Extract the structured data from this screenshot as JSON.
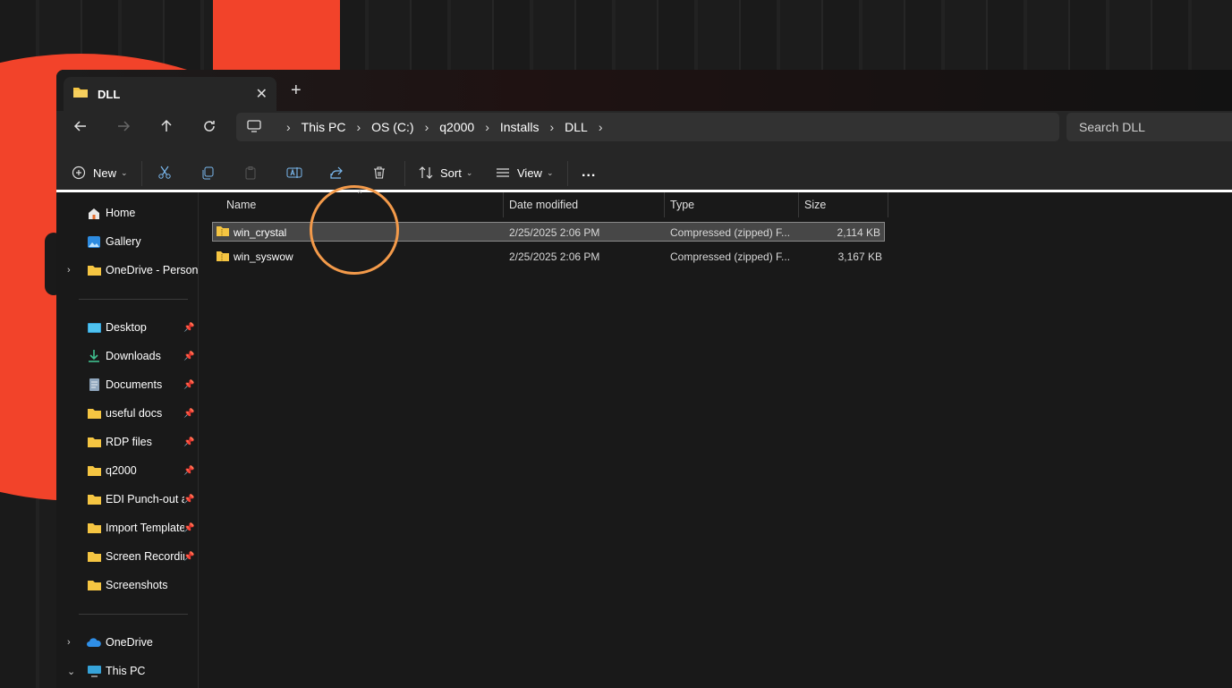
{
  "window": {
    "tab_title": "DLL"
  },
  "nav": {
    "breadcrumbs": [
      "This PC",
      "OS (C:)",
      "q2000",
      "Installs",
      "DLL"
    ],
    "search_placeholder": "Search DLL"
  },
  "toolbar": {
    "new_label": "New",
    "sort_label": "Sort",
    "view_label": "View",
    "more_label": "..."
  },
  "sidebar": {
    "items": [
      {
        "label": "Home",
        "icon": "home-icon"
      },
      {
        "label": "Gallery",
        "icon": "gallery-icon"
      },
      {
        "label": "OneDrive - Persona",
        "icon": "folder-icon"
      },
      {
        "label": "Desktop",
        "icon": "desktop-icon",
        "pinned": true
      },
      {
        "label": "Downloads",
        "icon": "download-icon",
        "pinned": true
      },
      {
        "label": "Documents",
        "icon": "documents-icon",
        "pinned": true
      },
      {
        "label": "useful docs",
        "icon": "folder-icon",
        "pinned": true
      },
      {
        "label": "RDP files",
        "icon": "folder-icon",
        "pinned": true
      },
      {
        "label": "q2000",
        "icon": "folder-icon",
        "pinned": true
      },
      {
        "label": "EDI Punch-out a",
        "icon": "folder-icon",
        "pinned": true
      },
      {
        "label": "Import Template",
        "icon": "folder-icon",
        "pinned": true
      },
      {
        "label": "Screen Recordin",
        "icon": "folder-icon",
        "pinned": true
      },
      {
        "label": "Screenshots",
        "icon": "folder-icon"
      },
      {
        "label": "OneDrive",
        "icon": "cloud-icon"
      },
      {
        "label": "This PC",
        "icon": "pc-icon"
      }
    ]
  },
  "columns": [
    "Name",
    "Date modified",
    "Type",
    "Size"
  ],
  "files": [
    {
      "name": "win_crystal",
      "date": "2/25/2025 2:06 PM",
      "type": "Compressed (zipped) F...",
      "size": "2,114 KB",
      "selected": true
    },
    {
      "name": "win_syswow",
      "date": "2/25/2025 2:06 PM",
      "type": "Compressed (zipped) F...",
      "size": "3,167 KB",
      "selected": false
    }
  ],
  "colors": {
    "accent_folder": "#f5c542",
    "highlight_ring": "#f39a4a",
    "background_red": "#f2432a"
  }
}
